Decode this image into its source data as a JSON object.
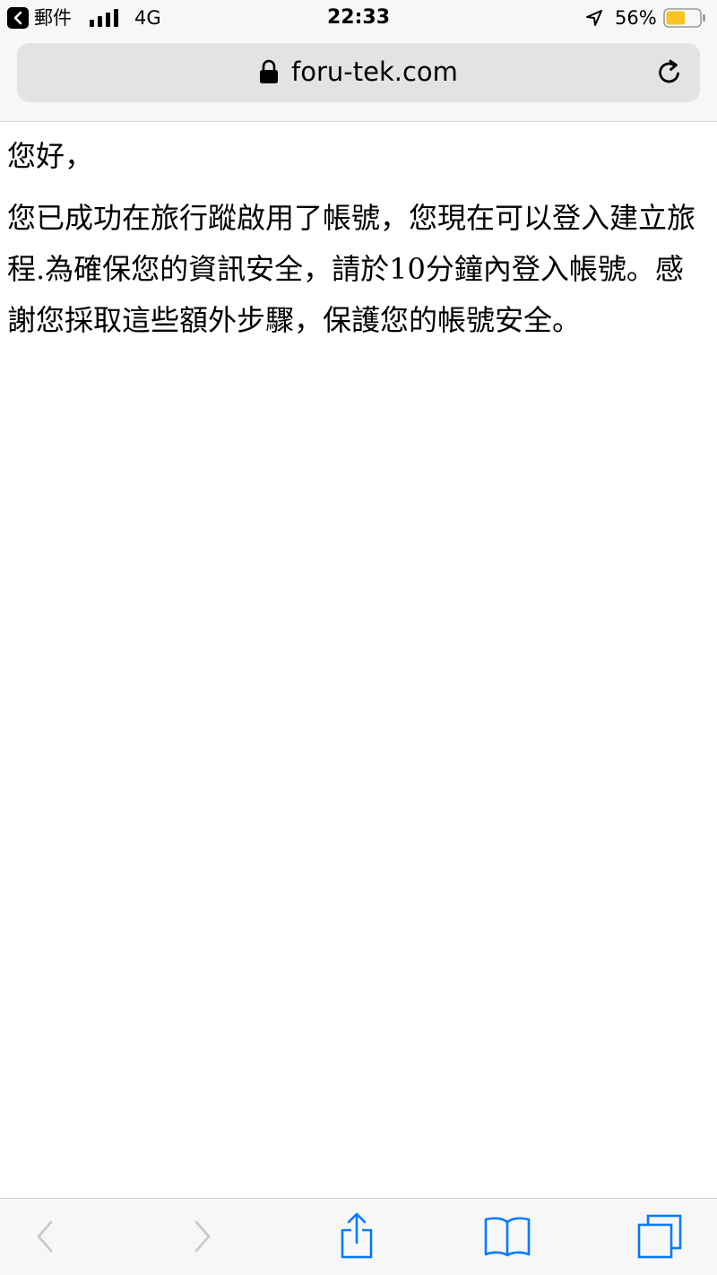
{
  "status_bar": {
    "back_app_label": "郵件",
    "network": "4G",
    "time": "22:33",
    "battery_percent": "56%",
    "battery_level": 0.56,
    "battery_color": "#f7c325"
  },
  "browser": {
    "url": "foru-tek.com",
    "accent": "#007aff",
    "disabled": "#c7c7cc"
  },
  "content": {
    "greeting": "您好，",
    "message": "您已成功在旅行蹤啟用了帳號，您現在可以登入建立旅程.為確保您的資訊安全，請於10分鐘內登入帳號。感謝您採取這些額外步驟，保護您的帳號安全。"
  },
  "toolbar": {
    "icons": [
      "back-icon",
      "forward-icon",
      "share-icon",
      "bookmarks-icon",
      "tabs-icon"
    ]
  }
}
